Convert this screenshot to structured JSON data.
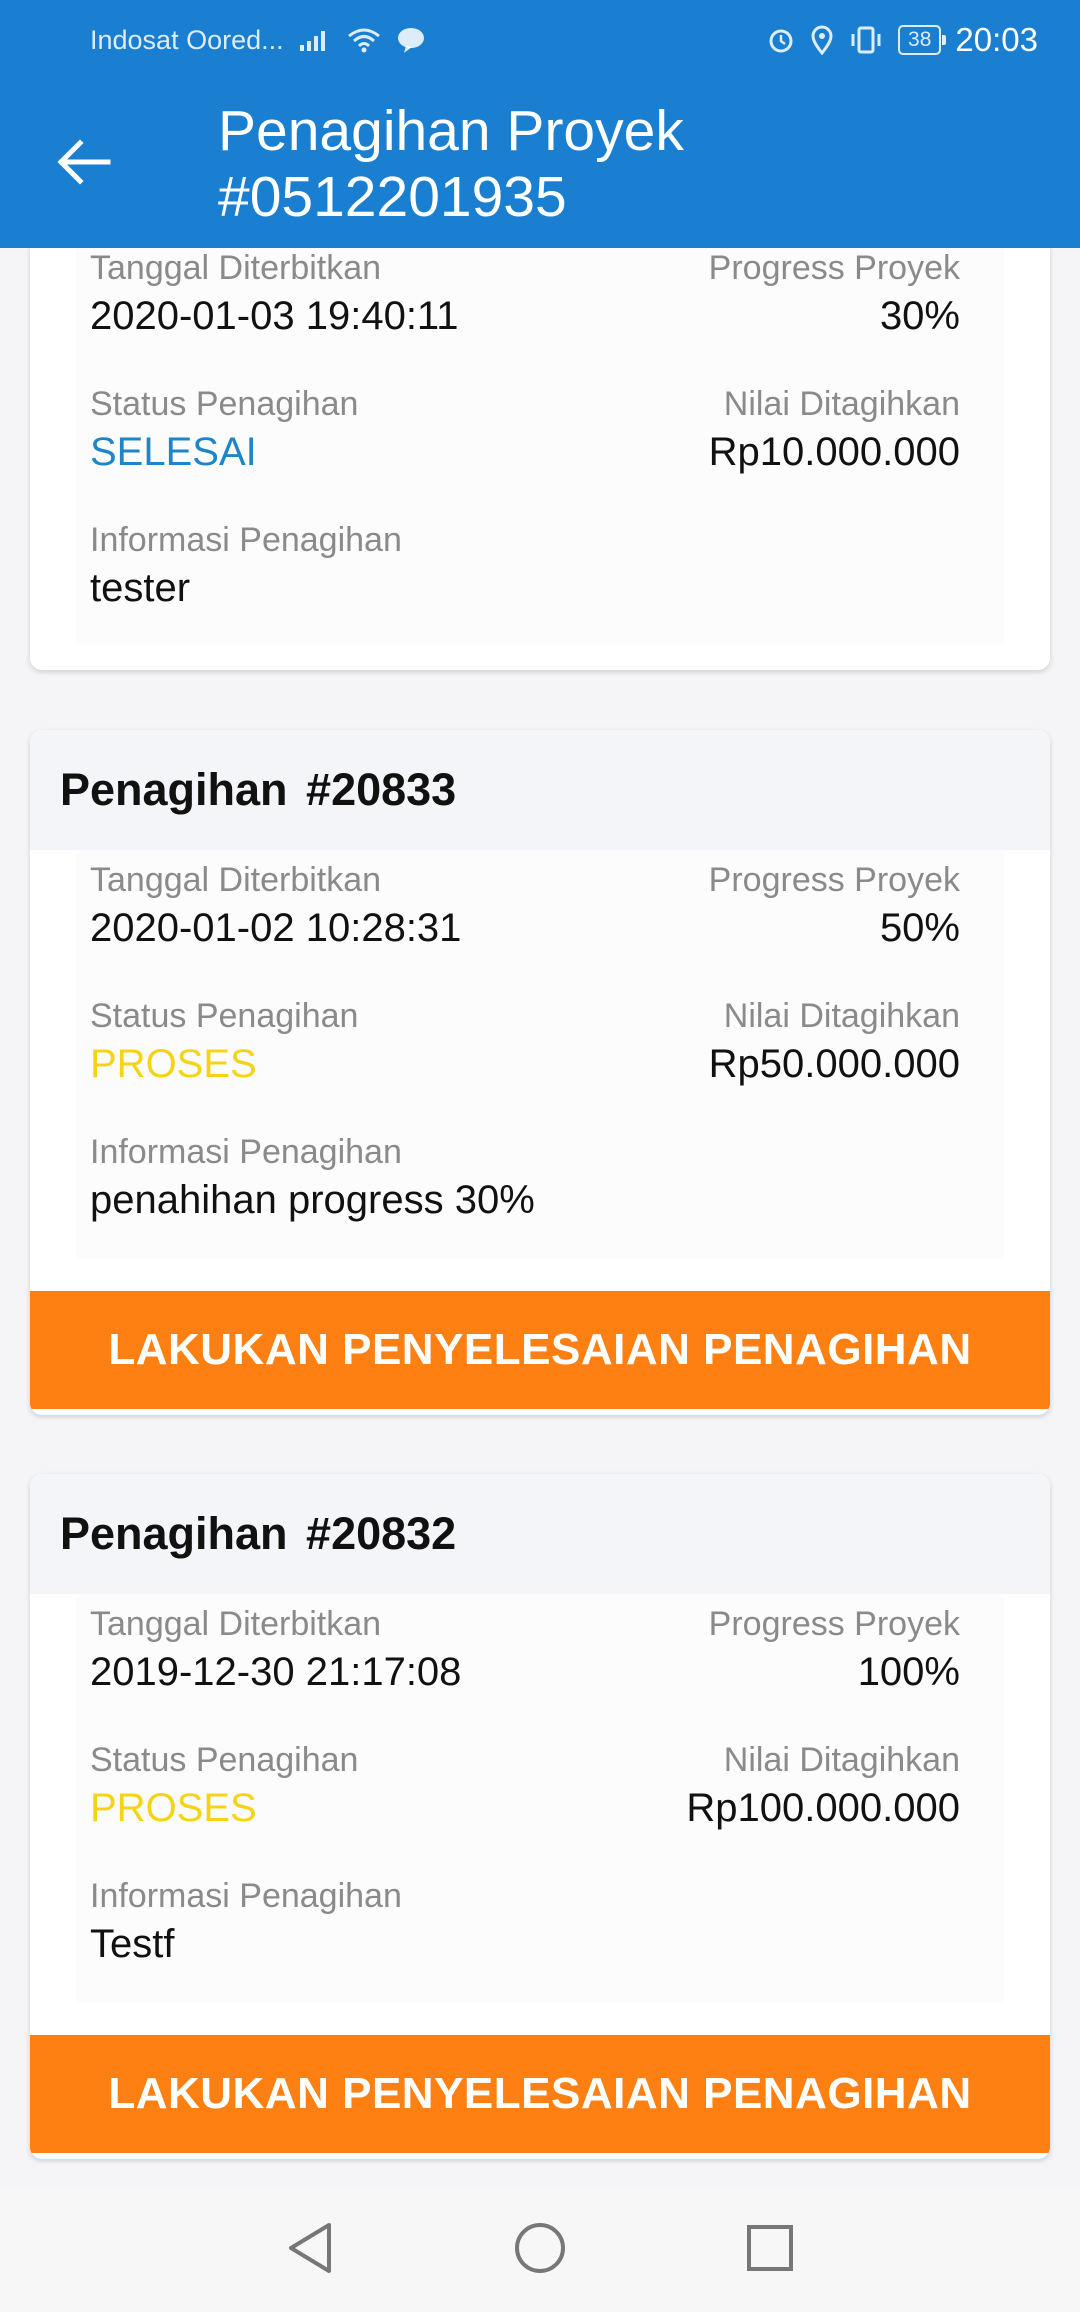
{
  "status_bar": {
    "carrier": "Indosat Oored...",
    "battery": "38",
    "time": "20:03"
  },
  "app_bar": {
    "title_line1": "Penagihan Proyek",
    "title_line2": "#0512201935"
  },
  "labels": {
    "date": "Tanggal Diterbitkan",
    "progress": "Progress Proyek",
    "status": "Status Penagihan",
    "amount": "Nilai Ditagihkan",
    "info": "Informasi Penagihan"
  },
  "billings": [
    {
      "date": "2020-01-03 19:40:11",
      "progress": "30%",
      "status": "SELESAI",
      "amount": "Rp10.000.000",
      "info": "tester"
    },
    {
      "header": "Penagihan  #20833",
      "date": "2020-01-02 10:28:31",
      "progress": "50%",
      "status": "PROSES",
      "amount": "Rp50.000.000",
      "info": "penahihan progress 30%",
      "action": "LAKUKAN PENYELESAIAN PENAGIHAN"
    },
    {
      "header": "Penagihan  #20832",
      "date": "2019-12-30 21:17:08",
      "progress": "100%",
      "status": "PROSES",
      "amount": "Rp100.000.000",
      "info": "Testf",
      "action": "LAKUKAN PENYELESAIAN PENAGIHAN"
    }
  ],
  "colors": {
    "app_bar": "#1a7fd1",
    "status_selesai": "#1e86c8",
    "status_proses": "#f7d316",
    "action_button": "#fe7f12"
  },
  "icons": {
    "back": "arrow-left-icon",
    "nav_back": "triangle-back-icon",
    "nav_home": "circle-home-icon",
    "nav_recent": "square-recent-icon"
  }
}
